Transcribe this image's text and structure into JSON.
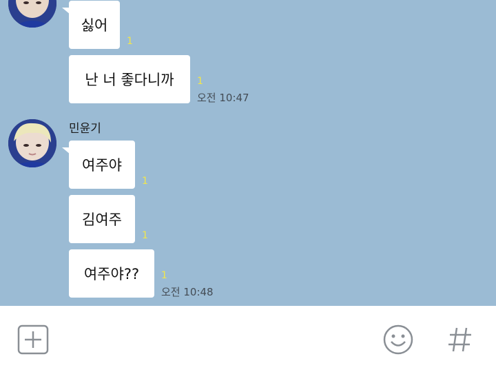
{
  "chat": {
    "messages": [
      {
        "text": "싫어",
        "unread": "1"
      },
      {
        "text": "난 너 좋다니까",
        "unread": "1",
        "time": "오전 10:47"
      },
      {
        "text": "여주야",
        "unread": "1"
      },
      {
        "text": "김여주",
        "unread": "1"
      },
      {
        "text": "여주야??",
        "unread": "1",
        "time": "오전 10:48"
      }
    ],
    "sender_name": "민윤기"
  },
  "input_bar": {
    "icons": [
      "plus-icon",
      "emoji-icon",
      "hashtag-icon"
    ]
  },
  "colors": {
    "chat_background": "#9bbbd4",
    "bubble": "#ffffff",
    "unread_count": "#f2e64b",
    "icon_gray": "#8a8f95"
  }
}
